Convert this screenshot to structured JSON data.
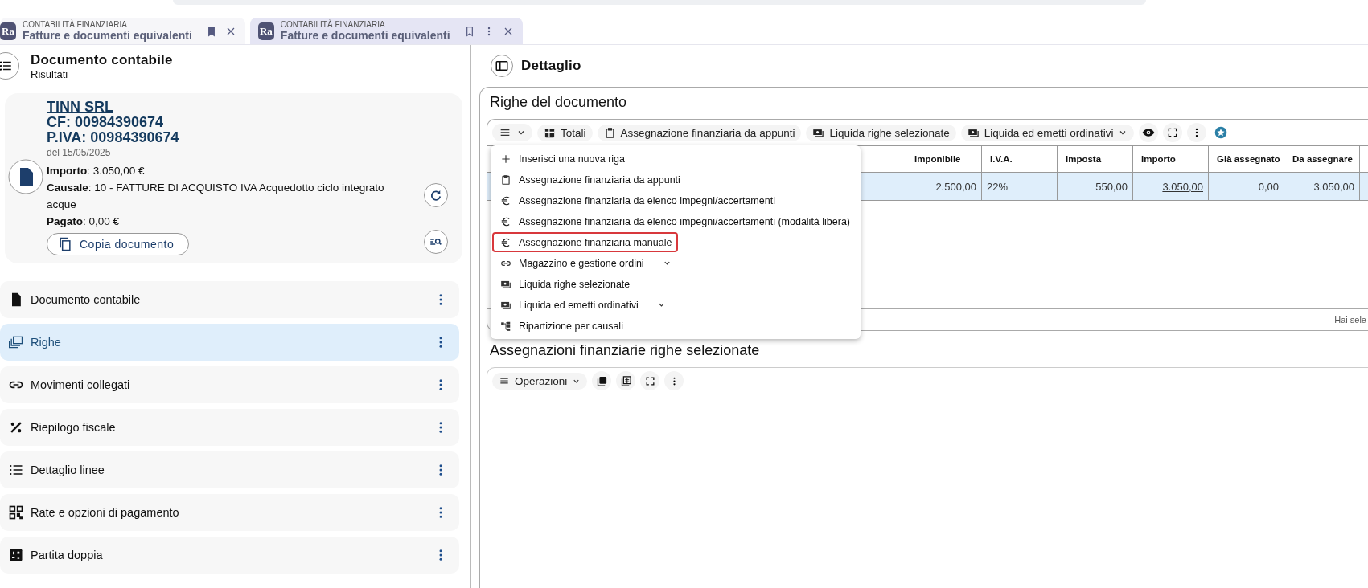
{
  "tabs": [
    {
      "logo": "Ra",
      "section": "CONTABILITÀ FINANZIARIA",
      "title": "Fatture e documenti equivalenti",
      "selected": false,
      "bookmarked": true
    },
    {
      "logo": "Ra",
      "section": "CONTABILITÀ FINANZIARIA",
      "title": "Fatture e documenti equivalenti",
      "selected": true,
      "bookmarked": false
    }
  ],
  "left": {
    "title": "Documento contabile",
    "subtitle": "Risultati",
    "card": {
      "name": "TINN SRL",
      "cf": "CF: 00984390674",
      "piva": "P.IVA: 00984390674",
      "date": "del 15/05/2025",
      "fields": [
        {
          "label": "Importo",
          "value": ": 3.050,00 €"
        },
        {
          "label": "Causale",
          "value": ": 10 - FATTURE DI ACQUISTO IVA Acquedotto ciclo integrato acque"
        },
        {
          "label": "Pagato",
          "value": ": 0,00 €"
        }
      ],
      "copy_button": "Copia documento"
    },
    "nav": [
      {
        "label": "Documento contabile",
        "kind": "file",
        "selected": false
      },
      {
        "label": "Righe",
        "kind": "layers",
        "selected": true
      },
      {
        "label": "Movimenti collegati",
        "kind": "link",
        "selected": false
      },
      {
        "label": "Riepilogo fiscale",
        "kind": "percent",
        "selected": false
      },
      {
        "label": "Dettaglio linee",
        "kind": "list",
        "selected": false
      },
      {
        "label": "Rate e opzioni di pagamento",
        "kind": "qr",
        "selected": false
      },
      {
        "label": "Partita doppia",
        "kind": "calc",
        "selected": false
      }
    ]
  },
  "detail": {
    "title": "Dettaglio",
    "lines": {
      "title": "Righe del documento",
      "toolbar": [
        {
          "label": "Totali",
          "kind": "grid",
          "caret": false
        },
        {
          "label": "Assegnazione finanziaria da appunti",
          "kind": "clipboard",
          "caret": false
        },
        {
          "label": "Liquida righe selezionate",
          "kind": "cash",
          "caret": false
        },
        {
          "label": "Liquida ed emetti ordinativi",
          "kind": "cash",
          "caret": true
        }
      ],
      "columns": [
        {
          "label": "Imponibile",
          "numeric": true
        },
        {
          "label": "I.V.A.",
          "numeric": false
        },
        {
          "label": "Imposta",
          "numeric": true
        },
        {
          "label": "Importo",
          "numeric": true
        },
        {
          "label": "Già assegnato",
          "numeric": true
        },
        {
          "label": "Da assegnare",
          "numeric": true
        }
      ],
      "rows": [
        {
          "selected": true,
          "cells": [
            {
              "text": "2.500,00",
              "link": false
            },
            {
              "text": "22%",
              "link": false
            },
            {
              "text": "550,00",
              "link": false
            },
            {
              "text": "3.050,00",
              "link": true
            },
            {
              "text": "0,00",
              "link": false
            },
            {
              "text": "3.050,00",
              "link": false
            }
          ]
        }
      ],
      "footer": "Hai sele",
      "menu": [
        {
          "label": "Inserisci una nuova riga",
          "kind": "plus",
          "submenu": false,
          "highlighted": false
        },
        {
          "label": "Assegnazione finanziaria da appunti",
          "kind": "clipboard",
          "submenu": false,
          "highlighted": false
        },
        {
          "label": "Assegnazione finanziaria da elenco impegni/accertamenti",
          "kind": "euro",
          "submenu": false,
          "highlighted": false
        },
        {
          "label": "Assegnazione finanziaria da elenco impegni/accertamenti (modalità libera)",
          "kind": "euro",
          "submenu": false,
          "highlighted": false
        },
        {
          "label": "Assegnazione finanziaria manuale",
          "kind": "euro",
          "submenu": false,
          "highlighted": true
        },
        {
          "label": "Magazzino e gestione ordini",
          "kind": "link",
          "submenu": true,
          "highlighted": false
        },
        {
          "label": "Liquida righe selezionate",
          "kind": "cash",
          "submenu": false,
          "highlighted": false
        },
        {
          "label": "Liquida ed emetti ordinativi",
          "kind": "cash",
          "submenu": true,
          "highlighted": false
        },
        {
          "label": "Ripartizione per causali",
          "kind": "tree",
          "submenu": false,
          "highlighted": false
        }
      ]
    },
    "assignments": {
      "title": "Assegnazioni finanziarie righe selezionate",
      "operations": "Operazioni"
    }
  }
}
